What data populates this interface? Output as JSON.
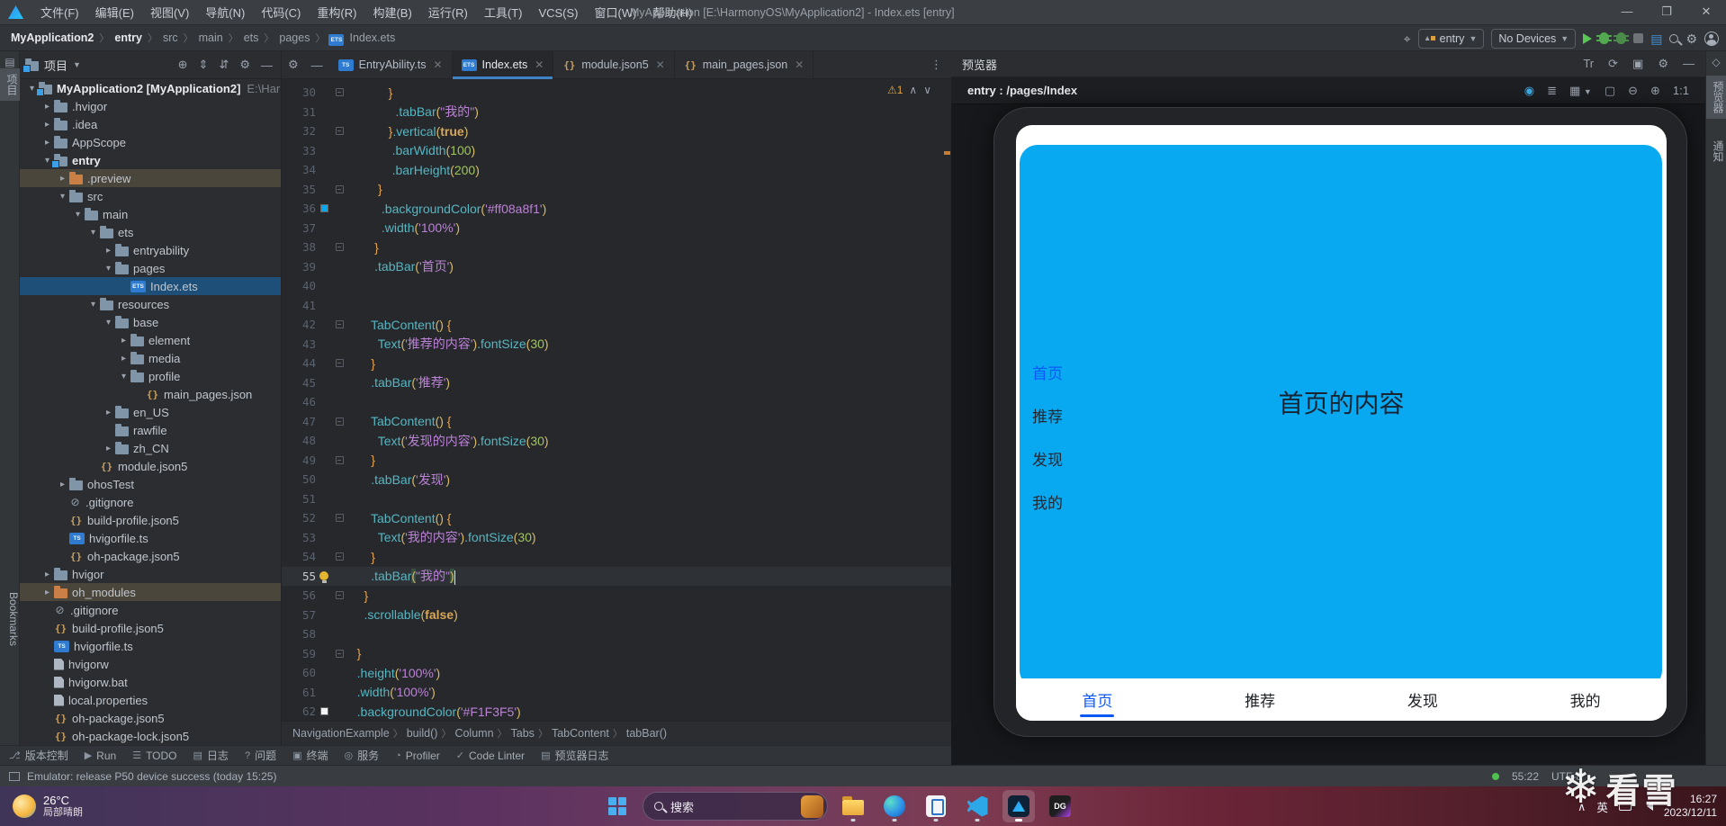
{
  "window": {
    "app_title": "MyApplication [E:\\HarmonyOS\\MyApplication2] - Index.ets [entry]",
    "menus": [
      "文件(F)",
      "编辑(E)",
      "视图(V)",
      "导航(N)",
      "代码(C)",
      "重构(R)",
      "构建(B)",
      "运行(R)",
      "工具(T)",
      "VCS(S)",
      "窗口(W)",
      "帮助(H)"
    ],
    "controls": [
      "—",
      "❐",
      "✕"
    ]
  },
  "navbar": {
    "breadcrumbs": [
      "MyApplication2",
      "entry",
      "src",
      "main",
      "ets",
      "pages",
      "Index.ets"
    ],
    "module_selector": "entry",
    "device_selector": "No Devices"
  },
  "left_strip": {
    "project_tab": "项目",
    "bookmarks_tab": "Bookmarks"
  },
  "right_strip": {
    "tabs": [
      "预览器",
      "通知"
    ]
  },
  "project": {
    "title": "项目",
    "tree": [
      {
        "ind": 0,
        "arr": "v",
        "ic": "mod",
        "t": "MyApplication2 [MyApplication2]",
        "x": "E:\\Harm",
        "bold": 1
      },
      {
        "ind": 1,
        "arr": ">",
        "ic": "fol",
        "t": ".hvigor"
      },
      {
        "ind": 1,
        "arr": ">",
        "ic": "fol",
        "t": ".idea"
      },
      {
        "ind": 1,
        "arr": ">",
        "ic": "fol",
        "t": "AppScope"
      },
      {
        "ind": 1,
        "arr": "v",
        "ic": "mod",
        "t": "entry",
        "bold": 1
      },
      {
        "ind": 2,
        "arr": ">",
        "ic": "folo",
        "t": ".preview",
        "sel": "h"
      },
      {
        "ind": 2,
        "arr": "v",
        "ic": "fol",
        "t": "src"
      },
      {
        "ind": 3,
        "arr": "v",
        "ic": "fol",
        "t": "main"
      },
      {
        "ind": 4,
        "arr": "v",
        "ic": "fol",
        "t": "ets"
      },
      {
        "ind": 5,
        "arr": ">",
        "ic": "fol",
        "t": "entryability"
      },
      {
        "ind": 5,
        "arr": "v",
        "ic": "fol",
        "t": "pages"
      },
      {
        "ind": 6,
        "arr": "",
        "ic": "ets",
        "t": "Index.ets",
        "sel": "b"
      },
      {
        "ind": 4,
        "arr": "v",
        "ic": "fol",
        "t": "resources"
      },
      {
        "ind": 5,
        "arr": "v",
        "ic": "fol",
        "t": "base"
      },
      {
        "ind": 6,
        "arr": ">",
        "ic": "fol",
        "t": "element"
      },
      {
        "ind": 6,
        "arr": ">",
        "ic": "fol",
        "t": "media"
      },
      {
        "ind": 6,
        "arr": "v",
        "ic": "fol",
        "t": "profile"
      },
      {
        "ind": 7,
        "arr": "",
        "ic": "json",
        "t": "main_pages.json"
      },
      {
        "ind": 5,
        "arr": ">",
        "ic": "fol",
        "t": "en_US"
      },
      {
        "ind": 5,
        "arr": "",
        "ic": "fol",
        "t": "rawfile"
      },
      {
        "ind": 5,
        "arr": ">",
        "ic": "fol",
        "t": "zh_CN"
      },
      {
        "ind": 4,
        "arr": "",
        "ic": "json",
        "t": "module.json5"
      },
      {
        "ind": 2,
        "arr": ">",
        "ic": "fol",
        "t": "ohosTest"
      },
      {
        "ind": 2,
        "arr": "",
        "ic": "git",
        "t": ".gitignore"
      },
      {
        "ind": 2,
        "arr": "",
        "ic": "json",
        "t": "build-profile.json5"
      },
      {
        "ind": 2,
        "arr": "",
        "ic": "ts",
        "t": "hvigorfile.ts"
      },
      {
        "ind": 2,
        "arr": "",
        "ic": "json",
        "t": "oh-package.json5"
      },
      {
        "ind": 1,
        "arr": ">",
        "ic": "fol",
        "t": "hvigor"
      },
      {
        "ind": 1,
        "arr": ">",
        "ic": "folo",
        "t": "oh_modules",
        "sel": "h"
      },
      {
        "ind": 1,
        "arr": "",
        "ic": "git",
        "t": ".gitignore"
      },
      {
        "ind": 1,
        "arr": "",
        "ic": "json",
        "t": "build-profile.json5"
      },
      {
        "ind": 1,
        "arr": "",
        "ic": "ts",
        "t": "hvigorfile.ts"
      },
      {
        "ind": 1,
        "arr": "",
        "ic": "file",
        "t": "hvigorw"
      },
      {
        "ind": 1,
        "arr": "",
        "ic": "file",
        "t": "hvigorw.bat"
      },
      {
        "ind": 1,
        "arr": "",
        "ic": "file",
        "t": "local.properties"
      },
      {
        "ind": 1,
        "arr": "",
        "ic": "json",
        "t": "oh-package.json5"
      },
      {
        "ind": 1,
        "arr": "",
        "ic": "json",
        "t": "oh-package-lock.json5"
      }
    ]
  },
  "editor": {
    "tabs": [
      {
        "label": "EntryAbility.ts",
        "icon": "ts",
        "active": false
      },
      {
        "label": "Index.ets",
        "icon": "ets",
        "active": true
      },
      {
        "label": "module.json5",
        "icon": "json",
        "active": false
      },
      {
        "label": "main_pages.json",
        "icon": "json",
        "active": false
      }
    ],
    "close_glyph": "✕",
    "warning_icon": "⚠",
    "warning_count": "1",
    "nav_up": "∧",
    "nav_down": "∨",
    "breadcrumb": [
      "NavigationExample",
      "build()",
      "Column",
      "Tabs",
      "TabContent",
      "tabBar()"
    ],
    "lines": [
      {
        "n": 30,
        "f": 1,
        "seg": [
          [
            "            }",
            "pu"
          ]
        ]
      },
      {
        "n": 31,
        "seg": [
          [
            "              ",
            ""
          ],
          [
            ".tabBar",
            "fn"
          ],
          [
            "(",
            "pa"
          ],
          [
            "\"我的\"",
            "str"
          ],
          [
            ")",
            "pa"
          ]
        ]
      },
      {
        "n": 32,
        "f": 1,
        "seg": [
          [
            "            }",
            "pu"
          ],
          [
            ".vertical",
            "fn"
          ],
          [
            "(",
            "pa"
          ],
          [
            "true",
            "kw"
          ],
          [
            ")",
            "pa"
          ]
        ]
      },
      {
        "n": 33,
        "seg": [
          [
            "             ",
            ""
          ],
          [
            ".barWidth",
            "fn"
          ],
          [
            "(",
            "pa"
          ],
          [
            "100",
            "num"
          ],
          [
            ")",
            "pa"
          ]
        ]
      },
      {
        "n": 34,
        "seg": [
          [
            "             ",
            ""
          ],
          [
            ".barHeight",
            "fn"
          ],
          [
            "(",
            "pa"
          ],
          [
            "200",
            "num"
          ],
          [
            ")",
            "pa"
          ]
        ]
      },
      {
        "n": 35,
        "f": 1,
        "seg": [
          [
            "         }",
            "pu"
          ]
        ]
      },
      {
        "n": 36,
        "swatch": "#08a8f1",
        "seg": [
          [
            "          ",
            ""
          ],
          [
            ".backgroundColor",
            "fn"
          ],
          [
            "(",
            "pa"
          ],
          [
            "'#ff08a8f1'",
            "str"
          ],
          [
            ")",
            "pa"
          ]
        ]
      },
      {
        "n": 37,
        "seg": [
          [
            "          ",
            ""
          ],
          [
            ".width",
            "fn"
          ],
          [
            "(",
            "pa"
          ],
          [
            "'100%'",
            "str"
          ],
          [
            ")",
            "pa"
          ]
        ]
      },
      {
        "n": 38,
        "f": 1,
        "seg": [
          [
            "        }",
            "pu"
          ]
        ]
      },
      {
        "n": 39,
        "seg": [
          [
            "        ",
            ""
          ],
          [
            ".tabBar",
            "fn"
          ],
          [
            "(",
            "pa"
          ],
          [
            "'首页'",
            "str"
          ],
          [
            ")",
            "pa"
          ]
        ]
      },
      {
        "n": 40,
        "seg": []
      },
      {
        "n": 41,
        "seg": []
      },
      {
        "n": 42,
        "f": 1,
        "seg": [
          [
            "       ",
            ""
          ],
          [
            "TabContent",
            "fn"
          ],
          [
            "()",
            "pa"
          ],
          [
            " {",
            "pu"
          ]
        ]
      },
      {
        "n": 43,
        "seg": [
          [
            "         ",
            ""
          ],
          [
            "Text",
            "fn"
          ],
          [
            "(",
            "pa"
          ],
          [
            "'推荐的内容'",
            "str"
          ],
          [
            ")",
            "pa"
          ],
          [
            ".fontSize",
            "fn"
          ],
          [
            "(",
            "pa"
          ],
          [
            "30",
            "num"
          ],
          [
            ")",
            "pa"
          ]
        ]
      },
      {
        "n": 44,
        "f": 1,
        "seg": [
          [
            "       }",
            "pu"
          ]
        ]
      },
      {
        "n": 45,
        "seg": [
          [
            "       ",
            ""
          ],
          [
            ".tabBar",
            "fn"
          ],
          [
            "(",
            "pa"
          ],
          [
            "'推荐'",
            "str"
          ],
          [
            ")",
            "pa"
          ]
        ]
      },
      {
        "n": 46,
        "seg": []
      },
      {
        "n": 47,
        "f": 1,
        "seg": [
          [
            "       ",
            ""
          ],
          [
            "TabContent",
            "fn"
          ],
          [
            "()",
            "pa"
          ],
          [
            " {",
            "pu"
          ]
        ]
      },
      {
        "n": 48,
        "seg": [
          [
            "         ",
            ""
          ],
          [
            "Text",
            "fn"
          ],
          [
            "(",
            "pa"
          ],
          [
            "'发现的内容'",
            "str"
          ],
          [
            ")",
            "pa"
          ],
          [
            ".fontSize",
            "fn"
          ],
          [
            "(",
            "pa"
          ],
          [
            "30",
            "num"
          ],
          [
            ")",
            "pa"
          ]
        ]
      },
      {
        "n": 49,
        "f": 1,
        "seg": [
          [
            "       }",
            "pu"
          ]
        ]
      },
      {
        "n": 50,
        "seg": [
          [
            "       ",
            ""
          ],
          [
            ".tabBar",
            "fn"
          ],
          [
            "(",
            "pa"
          ],
          [
            "'发现'",
            "str"
          ],
          [
            ")",
            "pa"
          ]
        ]
      },
      {
        "n": 51,
        "seg": []
      },
      {
        "n": 52,
        "f": 1,
        "seg": [
          [
            "       ",
            ""
          ],
          [
            "TabContent",
            "fn"
          ],
          [
            "()",
            "pa"
          ],
          [
            " {",
            "pu"
          ]
        ]
      },
      {
        "n": 53,
        "seg": [
          [
            "         ",
            ""
          ],
          [
            "Text",
            "fn"
          ],
          [
            "(",
            "pa"
          ],
          [
            "'我的内容'",
            "str"
          ],
          [
            ")",
            "pa"
          ],
          [
            ".fontSize",
            "fn"
          ],
          [
            "(",
            "pa"
          ],
          [
            "30",
            "num"
          ],
          [
            ")",
            "pa"
          ]
        ]
      },
      {
        "n": 54,
        "f": 1,
        "seg": [
          [
            "       }",
            "pu"
          ]
        ]
      },
      {
        "n": 55,
        "cur": 1,
        "bulb": 1,
        "cursor": 1,
        "seg": [
          [
            "       ",
            ""
          ],
          [
            ".tabBar",
            "fn"
          ],
          [
            "(",
            "pahl"
          ],
          [
            "\"我的\"",
            "str"
          ],
          [
            ")",
            "pahl"
          ]
        ]
      },
      {
        "n": 56,
        "f": 1,
        "seg": [
          [
            "     }",
            "pu"
          ]
        ]
      },
      {
        "n": 57,
        "seg": [
          [
            "     ",
            ""
          ],
          [
            ".scrollable",
            "fn"
          ],
          [
            "(",
            "pa"
          ],
          [
            "false",
            "kw"
          ],
          [
            ")",
            "pa"
          ]
        ]
      },
      {
        "n": 58,
        "seg": []
      },
      {
        "n": 59,
        "f": 1,
        "seg": [
          [
            "   }",
            "pu"
          ]
        ]
      },
      {
        "n": 60,
        "seg": [
          [
            "   ",
            ""
          ],
          [
            ".height",
            "fn"
          ],
          [
            "(",
            "pa"
          ],
          [
            "'100%'",
            "str"
          ],
          [
            ")",
            "pa"
          ]
        ]
      },
      {
        "n": 61,
        "seg": [
          [
            "   ",
            ""
          ],
          [
            ".width",
            "fn"
          ],
          [
            "(",
            "pa"
          ],
          [
            "'100%'",
            "str"
          ],
          [
            ")",
            "pa"
          ]
        ]
      },
      {
        "n": 62,
        "swatch": "#F1F3F5",
        "seg": [
          [
            "   ",
            ""
          ],
          [
            ".backgroundColor",
            "fn"
          ],
          [
            "(",
            "pa"
          ],
          [
            "'#F1F3F5'",
            "str"
          ],
          [
            ")",
            "pa"
          ]
        ]
      }
    ]
  },
  "preview": {
    "title": "预览器",
    "page": "entry : /pages/Index",
    "scale_label": "1:1",
    "h1_icons": [
      "Tr",
      "⟳",
      "▣",
      "⚙",
      "—"
    ],
    "content_color": "#09a9f2",
    "selected_color": "#0a59f7",
    "side_tabs": [
      {
        "label": "首页",
        "active": true
      },
      {
        "label": "推荐",
        "active": false
      },
      {
        "label": "发现",
        "active": false
      },
      {
        "label": "我的",
        "active": false
      }
    ],
    "center_text": "首页的内容",
    "bottom_tabs": [
      {
        "label": "首页",
        "active": true
      },
      {
        "label": "推荐",
        "active": false
      },
      {
        "label": "发现",
        "active": false
      },
      {
        "label": "我的",
        "active": false
      }
    ]
  },
  "bottom_bar": {
    "items": [
      {
        "ic": "⎇",
        "label": "版本控制"
      },
      {
        "ic": "▶",
        "label": "Run"
      },
      {
        "ic": "☰",
        "label": "TODO"
      },
      {
        "ic": "▤",
        "label": "日志"
      },
      {
        "ic": "?",
        "label": "问题"
      },
      {
        "ic": "▣",
        "label": "终端"
      },
      {
        "ic": "◎",
        "label": "服务"
      },
      {
        "ic": "◔",
        "label": "Profiler"
      },
      {
        "ic": "✓",
        "label": "Code Linter"
      },
      {
        "ic": "▤",
        "label": "预览器日志"
      }
    ]
  },
  "status_bar": {
    "message": "Emulator: release P50 device success (today 15:25)",
    "caret_position": "55:22",
    "encoding": "UTF-8"
  },
  "taskbar": {
    "weather_temp": "26°C",
    "weather_desc": "局部晴朗",
    "search_placeholder": "搜索",
    "apps": [
      "start",
      "search",
      "explorer",
      "edge",
      "phone-link",
      "vscode",
      "deveco-studio",
      "datagrip"
    ],
    "tray_chevron": "∧",
    "lang": "英",
    "time": "16:27",
    "date": "2023/12/11"
  },
  "watermark": {
    "flake": "❄",
    "text": "看雪"
  }
}
